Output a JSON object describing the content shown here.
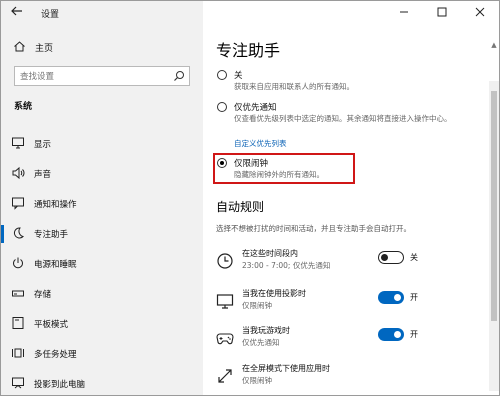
{
  "app": {
    "title": "设置"
  },
  "left": {
    "home": "主页",
    "search_placeholder": "查找设置",
    "section": "系统",
    "items": [
      {
        "label": "显示",
        "icon": "monitor-icon"
      },
      {
        "label": "声音",
        "icon": "speaker-icon"
      },
      {
        "label": "通知和操作",
        "icon": "notification-icon"
      },
      {
        "label": "专注助手",
        "icon": "moon-icon",
        "active": true
      },
      {
        "label": "电源和睡眠",
        "icon": "power-icon"
      },
      {
        "label": "存储",
        "icon": "storage-icon"
      },
      {
        "label": "平板模式",
        "icon": "tablet-icon"
      },
      {
        "label": "多任务处理",
        "icon": "multitask-icon"
      },
      {
        "label": "投影到此电脑",
        "icon": "project-icon"
      }
    ]
  },
  "main": {
    "title": "专注助手",
    "options": [
      {
        "label": "关",
        "desc": "获取来自应用和联系人的所有通知。",
        "checked": false
      },
      {
        "label": "仅优先通知",
        "desc": "仅查看优先级列表中选定的通知。其余通知将直接进入操作中心。",
        "link": "自定义优先列表",
        "checked": false
      },
      {
        "label": "仅限闹钟",
        "desc": "隐藏除闹钟外的所有通知。",
        "checked": true
      }
    ],
    "auto_rules": {
      "title": "自动规则",
      "desc": "选择不想被打扰的时间和活动，并且专注助手会自动打开。",
      "rules": [
        {
          "title": "在这些时间段内",
          "sub": "23:00 - 7:00; 仅优先通知",
          "toggle": false,
          "state": "关",
          "icon": "clock-icon"
        },
        {
          "title": "当我在使用投影时",
          "sub": "仅限闹钟",
          "toggle": true,
          "state": "开",
          "icon": "projector-icon"
        },
        {
          "title": "当我玩游戏时",
          "sub": "仅优先通知",
          "toggle": true,
          "state": "开",
          "icon": "gamepad-icon"
        },
        {
          "title": "在全屏模式下使用应用时",
          "sub": "仅限闹钟",
          "icon": "fullscreen-icon"
        }
      ]
    }
  },
  "colors": {
    "accent": "#0067c0",
    "highlight": "#d01717",
    "link": "#0a62b5"
  }
}
